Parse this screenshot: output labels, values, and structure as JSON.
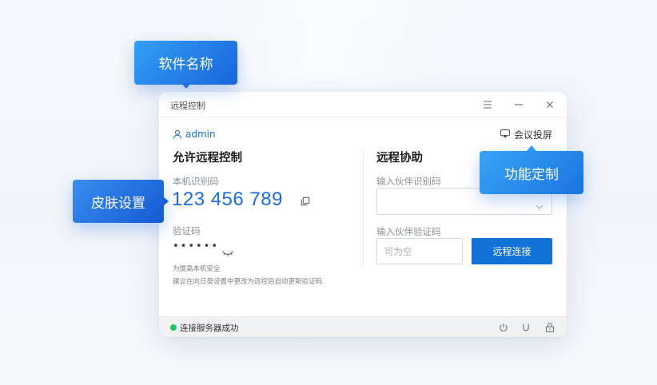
{
  "window": {
    "title": "远程控制",
    "controls": {
      "menu_icon": "hamburger-icon",
      "minimize_icon": "minimize-icon",
      "close_icon": "close-icon"
    }
  },
  "header": {
    "username": "admin",
    "user_icon": "user-icon",
    "meeting_label": "会议投屏",
    "meeting_icon": "screen-cast-icon"
  },
  "allow_control": {
    "title": "允许远程控制",
    "machine_id_label": "本机识别码",
    "machine_id": "123 456 789",
    "copy_icon": "copy-icon",
    "code_label": "验证码",
    "code_masked": "••••••",
    "eye_icon": "eye-closed-icon",
    "tip_line1": "为提高本机安全",
    "tip_line2": "建议在向日葵设置中更改为远控后自动更新验证码"
  },
  "remote_assist": {
    "title": "远程协助",
    "partner_id_label": "输入伙伴识别码",
    "partner_id_value": "",
    "partner_code_label": "输入伙伴验证码",
    "partner_code_placeholder": "可为空",
    "connect_label": "远程连接"
  },
  "status": {
    "text": "连接服务器成功",
    "color": "#22c55e",
    "icons": [
      "power-icon",
      "magnet-icon",
      "lock-icon"
    ]
  },
  "callouts": {
    "name": "软件名称",
    "skin": "皮肤设置",
    "feature": "功能定制"
  },
  "colors": {
    "accent": "#1272d8",
    "link": "#1a6ddf"
  }
}
